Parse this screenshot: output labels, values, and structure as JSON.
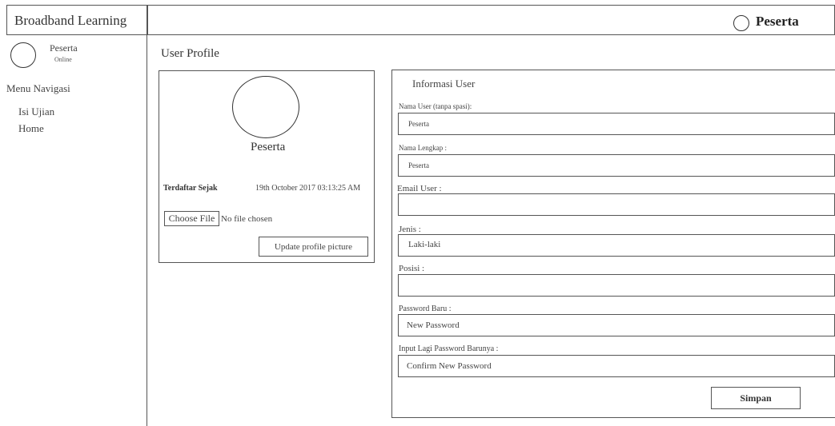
{
  "header": {
    "brand": "Broadband Learning",
    "user_name": "Peserta"
  },
  "sidebar": {
    "user_name": "Peserta",
    "user_status": "Online",
    "menu_title": "Menu Navigasi",
    "items": [
      {
        "label": "Isi Ujian"
      },
      {
        "label": "Home"
      }
    ]
  },
  "main": {
    "page_title": "User Profile"
  },
  "profile_card": {
    "name": "Peserta",
    "registered_label": "Terdaftar Sejak",
    "registered_value": "19th October 2017 03:13:25 AM",
    "choose_file_label": "Choose File",
    "no_file_text": "No file chosen",
    "update_button": "Update profile picture"
  },
  "user_info": {
    "title": "Informasi User",
    "fields": [
      {
        "label": "Nama User (tanpa spasi):",
        "value": "Peserta"
      },
      {
        "label": "Nama Lengkap :",
        "value": "Peserta"
      },
      {
        "label": "Email User :",
        "value": ""
      },
      {
        "label": "Jenis :",
        "value": "Laki-laki"
      },
      {
        "label": "Posisi :",
        "value": ""
      },
      {
        "label": "Password Baru :",
        "placeholder": "New Password"
      },
      {
        "label": "Input Lagi Password Barunya :",
        "placeholder": "Confirm New Password"
      }
    ],
    "save_button": "Simpan"
  }
}
